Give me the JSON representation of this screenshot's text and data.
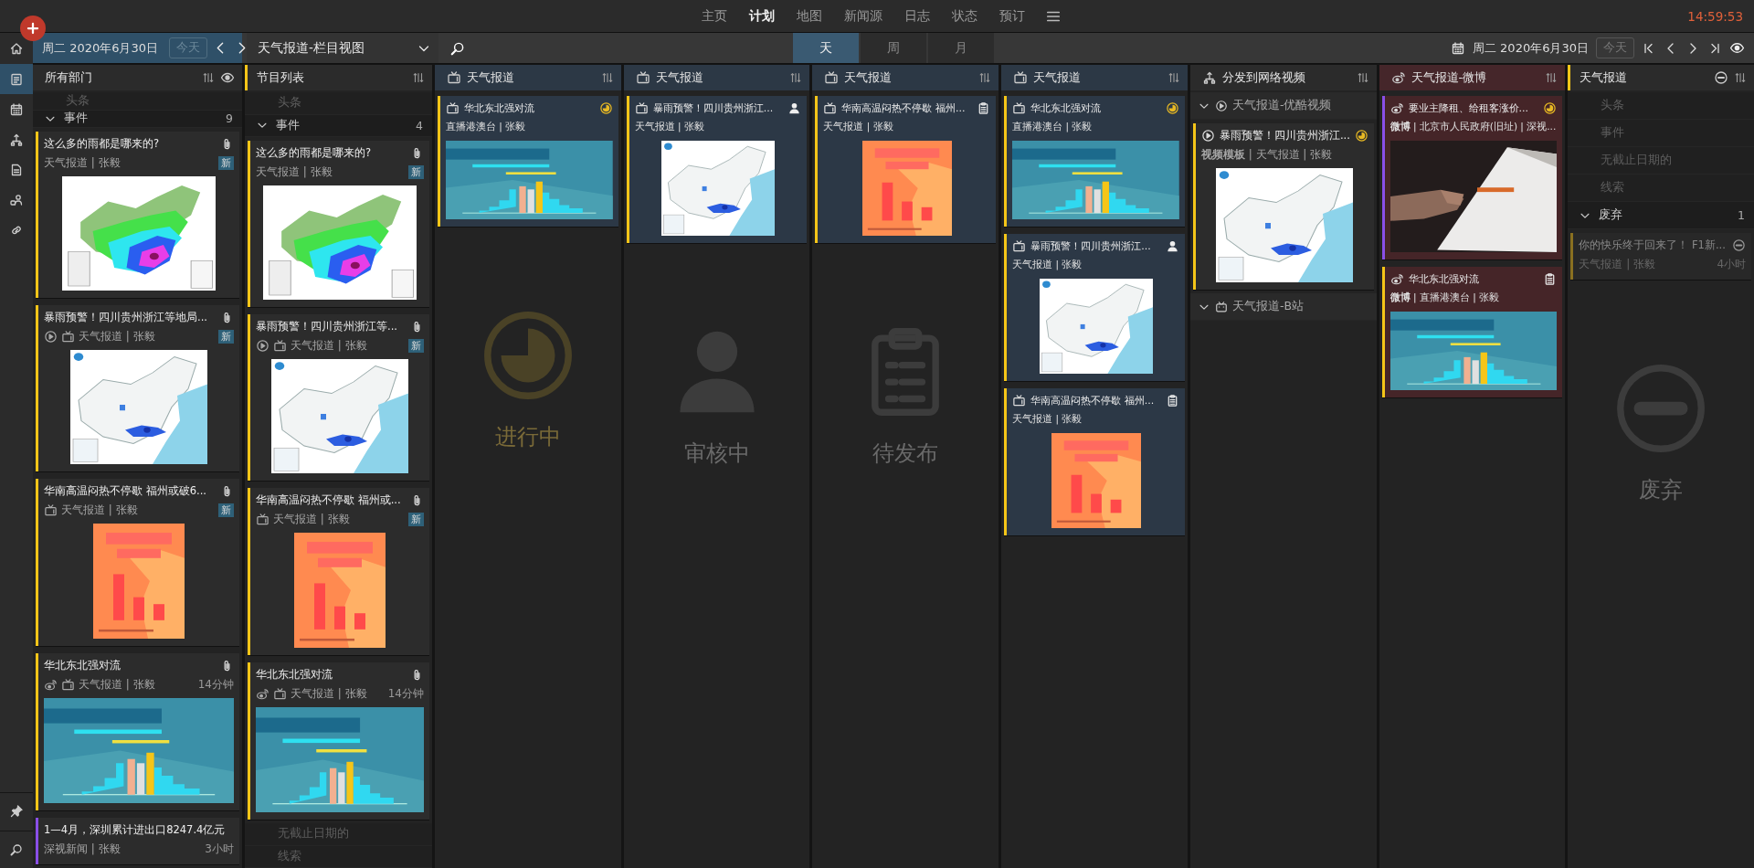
{
  "nav": {
    "items": [
      {
        "label": "主页",
        "selected": false
      },
      {
        "label": "计划",
        "selected": true
      },
      {
        "label": "地图",
        "selected": false
      },
      {
        "label": "新闻源",
        "selected": false
      },
      {
        "label": "日志",
        "selected": false
      },
      {
        "label": "状态",
        "selected": false
      },
      {
        "label": "预订",
        "selected": false
      }
    ],
    "clock": "14:59:53"
  },
  "toolbar": {
    "date": "周二 2020年6月30日",
    "today": "今天",
    "program": "天气报道-栏目视图",
    "view_tabs": [
      {
        "label": "天",
        "selected": true
      },
      {
        "label": "周",
        "selected": false
      },
      {
        "label": "月",
        "selected": false
      }
    ],
    "right_date": "周二 2020年6月30日",
    "right_today": "今天"
  },
  "rail": {
    "items": [
      {
        "kind": "home",
        "selected": false
      },
      {
        "kind": "document",
        "selected": true
      },
      {
        "kind": "calendar",
        "selected": false
      },
      {
        "kind": "share",
        "selected": false
      },
      {
        "kind": "file",
        "selected": false
      },
      {
        "kind": "people",
        "selected": false
      },
      {
        "kind": "link",
        "selected": false
      }
    ],
    "bottom": [
      {
        "kind": "pin"
      },
      {
        "kind": "search"
      }
    ]
  },
  "columns": [
    {
      "kind": "department",
      "title": "所有部门",
      "highlighted": false,
      "sections": [
        {
          "label": "头条"
        },
        {
          "label": "事件",
          "expanded": true,
          "count": "9",
          "cards": [
            {
              "title": "这么多的雨都是哪来的?",
              "color": "#f5c518",
              "attached": true,
              "badge": "新",
              "meta": "天气报道 | 张毅",
              "picture": {
                "kind": "rainfall"
              }
            },
            {
              "title": "暴雨预警！四川贵州浙江等地局...",
              "color": "#f5c518",
              "attached": true,
              "badge": "新",
              "platforms": [
                {
                  "kind": "video"
                },
                {
                  "kind": "broadcast"
                }
              ],
              "meta": "天气报道 | 张毅",
              "picture": {
                "kind": "map"
              }
            },
            {
              "title": "华南高温闷热不停歇 福州或破6...",
              "color": "#f5c518",
              "attached": true,
              "badge": "新",
              "platforms": [
                {
                  "kind": "broadcast"
                }
              ],
              "meta": "天气报道 | 张毅",
              "picture": {
                "kind": "chart"
              }
            },
            {
              "title": "华北东北强对流",
              "color": "#f5c518",
              "attached": true,
              "platforms": [
                {
                  "kind": "weibo"
                },
                {
                  "kind": "broadcast"
                }
              ],
              "meta": "天气报道 | 张毅",
              "time": "14分钟",
              "picture": {
                "kind": "infographic"
              }
            },
            {
              "title": "1—4月，深圳累计进出口8247.4亿元",
              "color": "#8a4fe8",
              "attached": false,
              "meta": "深视新闻 | 张毅",
              "time": "3小时"
            }
          ]
        }
      ]
    },
    {
      "kind": "program",
      "title": "节目列表",
      "highlighted": true,
      "sections": [
        {
          "label": "头条"
        },
        {
          "label": "事件",
          "expanded": true,
          "count": "4",
          "cards": [
            {
              "title": "这么多的雨都是哪来的?",
              "color": "#f5c518",
              "attached": true,
              "badge": "新",
              "meta": "天气报道 | 张毅",
              "picture": {
                "kind": "rainfall"
              }
            },
            {
              "title": "暴雨预警！四川贵州浙江等...",
              "color": "#f5c518",
              "attached": true,
              "badge": "新",
              "platforms": [
                {
                  "kind": "video"
                },
                {
                  "kind": "broadcast"
                }
              ],
              "meta": "天气报道 | 张毅",
              "picture": {
                "kind": "map"
              }
            },
            {
              "title": "华南高温闷热不停歇 福州或...",
              "color": "#f5c518",
              "attached": true,
              "badge": "新",
              "platforms": [
                {
                  "kind": "broadcast"
                }
              ],
              "meta": "天气报道 | 张毅",
              "picture": {
                "kind": "chart"
              }
            },
            {
              "title": "华北东北强对流",
              "color": "#f5c518",
              "attached": true,
              "platforms": [
                {
                  "kind": "weibo"
                },
                {
                  "kind": "broadcast"
                }
              ],
              "meta": "天气报道 | 张毅",
              "time": "14分钟",
              "picture": {
                "kind": "infographic"
              }
            }
          ]
        },
        {
          "label": "无截止日期的"
        },
        {
          "label": "线索"
        }
      ]
    },
    {
      "kind": "channel",
      "title": "天气报道",
      "highlighted": false,
      "cards": [
        {
          "title": "华北东北强对流",
          "color": "#f5c518",
          "platform": {
            "kind": "broadcast"
          },
          "kind": "in_progress",
          "meta": "直播港澳台 | 张毅",
          "picture": {
            "kind": "infographic"
          }
        }
      ],
      "empty_state": {
        "kind": "in_progress",
        "label": "进行中"
      }
    },
    {
      "kind": "channel",
      "title": "天气报道",
      "highlighted": false,
      "cards": [
        {
          "title": "暴雨预警！四川贵州浙江...",
          "color": "#f5c518",
          "platform": {
            "kind": "broadcast"
          },
          "kind": "review",
          "meta": "天气报道 | 张毅",
          "picture": {
            "kind": "map"
          }
        }
      ],
      "empty_state": {
        "kind": "review",
        "label": "审核中"
      }
    },
    {
      "kind": "channel",
      "title": "天气报道",
      "highlighted": false,
      "cards": [
        {
          "title": "华南高温闷热不停歇 福州...",
          "color": "#f5c518",
          "platform": {
            "kind": "broadcast"
          },
          "kind": "pending",
          "meta": "天气报道 | 张毅",
          "picture": {
            "kind": "chart"
          }
        }
      ],
      "empty_state": {
        "kind": "pending",
        "label": "待发布"
      }
    },
    {
      "kind": "channel",
      "title": "天气报道",
      "highlighted": false,
      "cards": [
        {
          "title": "华北东北强对流",
          "color": "#f5c518",
          "platform": {
            "kind": "broadcast"
          },
          "kind": "in_progress",
          "meta": "直播港澳台 | 张毅",
          "picture": {
            "kind": "infographic"
          }
        },
        {
          "title": "暴雨预警！四川贵州浙江...",
          "color": "#f5c518",
          "platform": {
            "kind": "broadcast"
          },
          "kind": "review",
          "meta": "天气报道 | 张毅",
          "picture": {
            "kind": "map"
          }
        },
        {
          "title": "华南高温闷热不停歇 福州...",
          "color": "#f5c518",
          "platform": {
            "kind": "broadcast"
          },
          "kind": "pending",
          "meta": "天气报道 | 张毅",
          "picture": {
            "kind": "chart"
          }
        }
      ]
    },
    {
      "kind": "distribution",
      "title": "分发到网络视频",
      "highlighted": false,
      "sections": [
        {
          "label": "天气报道-优酷视频",
          "kind": "video-channel",
          "expanded": true,
          "cards": [
            {
              "title": "暴雨预警！四川贵州浙江...",
              "color": "#f5c518",
              "platform": {
                "kind": "video"
              },
              "kind": "in_progress",
              "meta": "**视频模板** | 天气报道 | 张毅",
              "picture": {
                "kind": "map"
              }
            }
          ]
        },
        {
          "label": "天气报道-B站",
          "kind": "tv-channel",
          "expanded": true
        }
      ]
    },
    {
      "kind": "weibo",
      "title": "天气报道-微博",
      "highlighted": false,
      "cards": [
        {
          "title": "要业主降租、给租客涨价...",
          "color": "#8a4fe8",
          "platform": {
            "kind": "weibo"
          },
          "kind": "in_progress",
          "meta": "**微博** | 北京市人民政府(旧址) | 深视..."
        },
        {
          "title": "华北东北强对流",
          "color": "#f5c518",
          "platform": {
            "kind": "weibo"
          },
          "kind": "pending",
          "meta": "**微博** | 直播港澳台 | 张毅",
          "picture": {
            "kind": "infographic"
          }
        }
      ]
    },
    {
      "kind": "abandoned",
      "title": "天气报道",
      "highlighted": true,
      "sections": [
        {
          "label": "头条"
        },
        {
          "label": "事件"
        },
        {
          "label": "无截止日期的"
        },
        {
          "label": "线索"
        },
        {
          "label": "废弃",
          "expanded": true,
          "count": "1",
          "cards": [
            {
              "title": "你的快乐终于回来了！ F1新...",
              "color": "#8a7020",
              "kind": "discarded",
              "meta": "天气报道 | 张毅",
              "time": "4小时"
            }
          ]
        }
      ],
      "empty_state": {
        "kind": "discarded",
        "label": "废弃"
      }
    }
  ]
}
